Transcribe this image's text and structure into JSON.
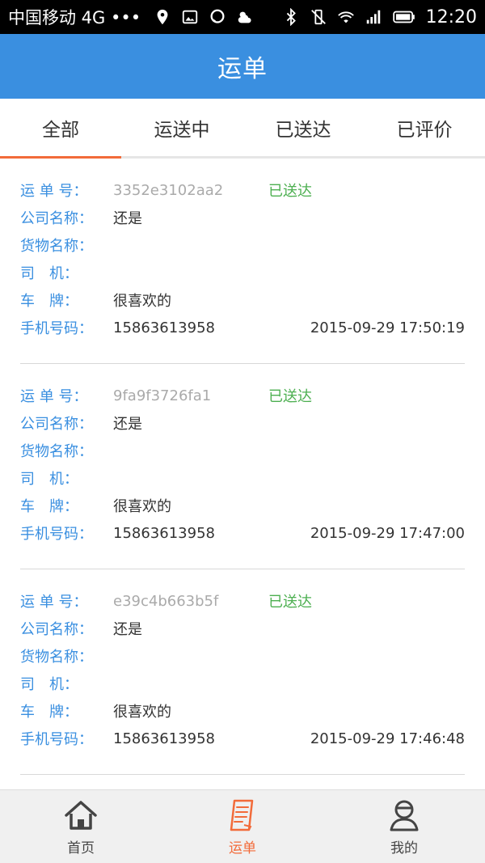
{
  "status_bar": {
    "carrier": "中国移动 4G •••",
    "time": "12:20"
  },
  "header": {
    "title": "运单"
  },
  "tabs": [
    {
      "label": "全部",
      "active": true
    },
    {
      "label": "运送中",
      "active": false
    },
    {
      "label": "已送达",
      "active": false
    },
    {
      "label": "已评价",
      "active": false
    }
  ],
  "labels": {
    "order_no": "运 单 号：",
    "company": "公司名称：",
    "goods": "货物名称：",
    "driver": "司　机：",
    "plate": "车　牌：",
    "phone": "手机号码："
  },
  "orders": [
    {
      "order_no": "3352e3102aa2",
      "status": "已送达",
      "company": "还是",
      "goods": "",
      "driver": "",
      "plate": "很喜欢的",
      "phone": "15863613958",
      "datetime": "2015-09-29 17:50:19"
    },
    {
      "order_no": "9fa9f3726fa1",
      "status": "已送达",
      "company": "还是",
      "goods": "",
      "driver": "",
      "plate": "很喜欢的",
      "phone": "15863613958",
      "datetime": "2015-09-29 17:47:00"
    },
    {
      "order_no": "e39c4b663b5f",
      "status": "已送达",
      "company": "还是",
      "goods": "",
      "driver": "",
      "plate": "很喜欢的",
      "phone": "15863613958",
      "datetime": "2015-09-29 17:46:48"
    }
  ],
  "bottom_nav": [
    {
      "label": "首页",
      "icon": "home-icon",
      "active": false
    },
    {
      "label": "运单",
      "icon": "waybill-icon",
      "active": true
    },
    {
      "label": "我的",
      "icon": "profile-icon",
      "active": false
    }
  ],
  "colors": {
    "header": "#3a8fe0",
    "accent": "#f26b3a",
    "label": "#3a8fe0",
    "status_delivered": "#4caf50"
  }
}
